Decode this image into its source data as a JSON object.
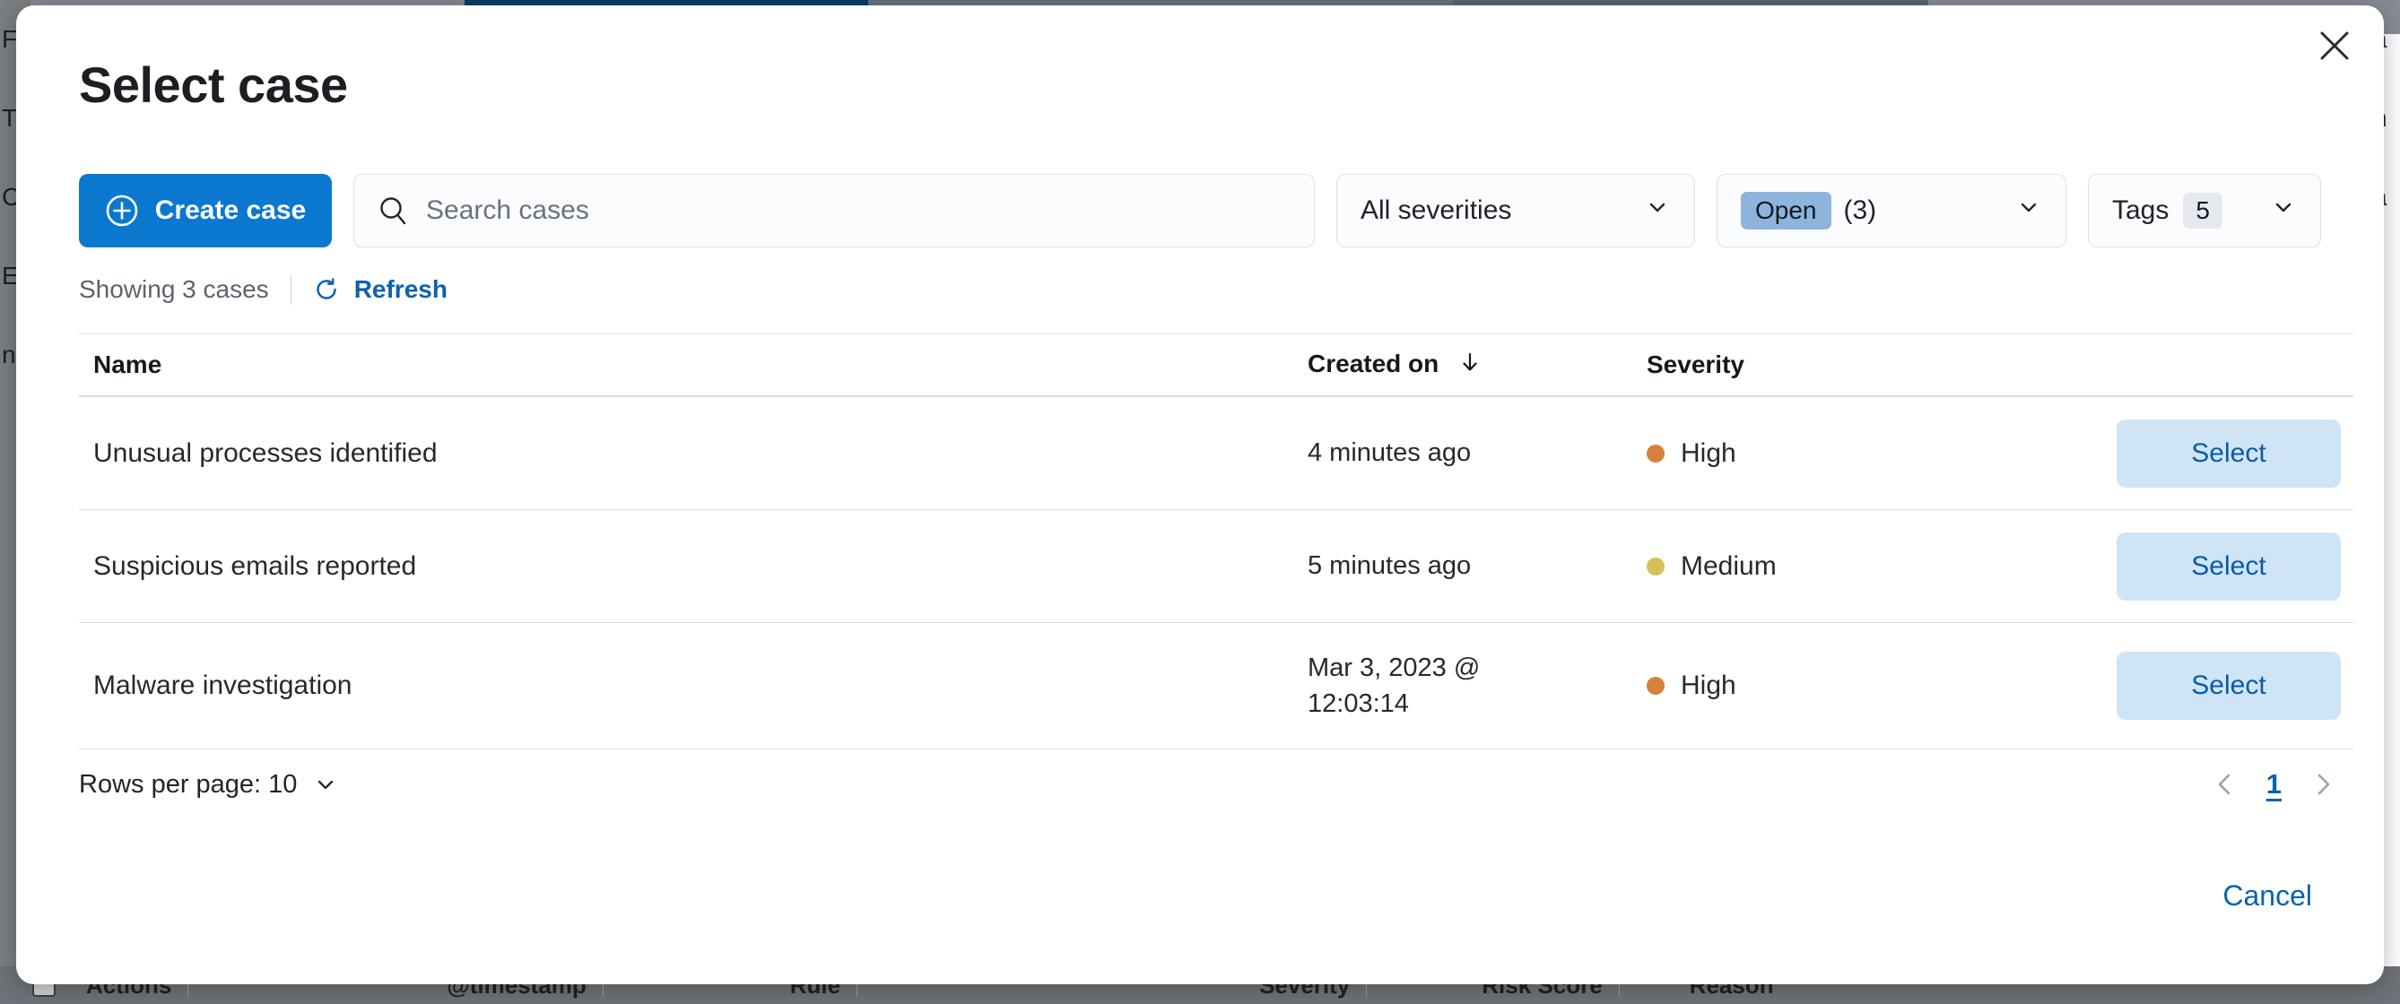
{
  "background": {
    "left_labels": [
      "Findings",
      "Time",
      "Ca",
      "Ex",
      "n"
    ],
    "right_labels": [
      "a",
      "n",
      "a"
    ],
    "table_headers": [
      "Actions",
      "@timestamp",
      "Rule",
      "Severity",
      "Risk Score",
      "Reason"
    ]
  },
  "modal": {
    "title": "Select case",
    "close_icon": "close-icon"
  },
  "toolbar": {
    "create_label": "Create case",
    "create_icon": "plus-circle-icon",
    "search_placeholder": "Search cases",
    "search_value": "",
    "search_icon": "search-icon",
    "severity_filter_label": "All severities",
    "status_filter_pill": "Open",
    "status_filter_count": "(3)",
    "tags_filter_label": "Tags",
    "tags_filter_badge": "5",
    "chevron_icon": "chevron-down-icon"
  },
  "summary": {
    "showing_text": "Showing 3 cases",
    "refresh_label": "Refresh",
    "refresh_icon": "refresh-icon"
  },
  "table": {
    "columns": [
      "Name",
      "Created on",
      "Severity"
    ],
    "sort_column": "Created on",
    "sort_icon": "arrow-down-icon",
    "select_label": "Select",
    "rows": [
      {
        "name": "Unusual processes identified",
        "created_on": "4 minutes ago",
        "severity": "High",
        "severity_color": "#d5813c",
        "action": "Select"
      },
      {
        "name": "Suspicious emails reported",
        "created_on": "5 minutes ago",
        "severity": "Medium",
        "severity_color": "#d6c059",
        "action": "Select"
      },
      {
        "name": "Malware investigation",
        "created_on": "Mar 3, 2023 @ 12:03:14",
        "severity": "High",
        "severity_color": "#d5813c",
        "action": "Select"
      }
    ]
  },
  "footer": {
    "rows_per_page_label": "Rows per page: 10",
    "rows_per_page_icon": "chevron-down-icon",
    "prev_icon": "chevron-left-icon",
    "next_icon": "chevron-right-icon",
    "current_page": "1",
    "cancel_label": "Cancel"
  },
  "colors": {
    "primary": "#0b78d0",
    "link": "#0b62ae",
    "select_button_bg": "#cfe5f6",
    "severity_high": "#d5813c",
    "severity_medium": "#d6c059"
  }
}
